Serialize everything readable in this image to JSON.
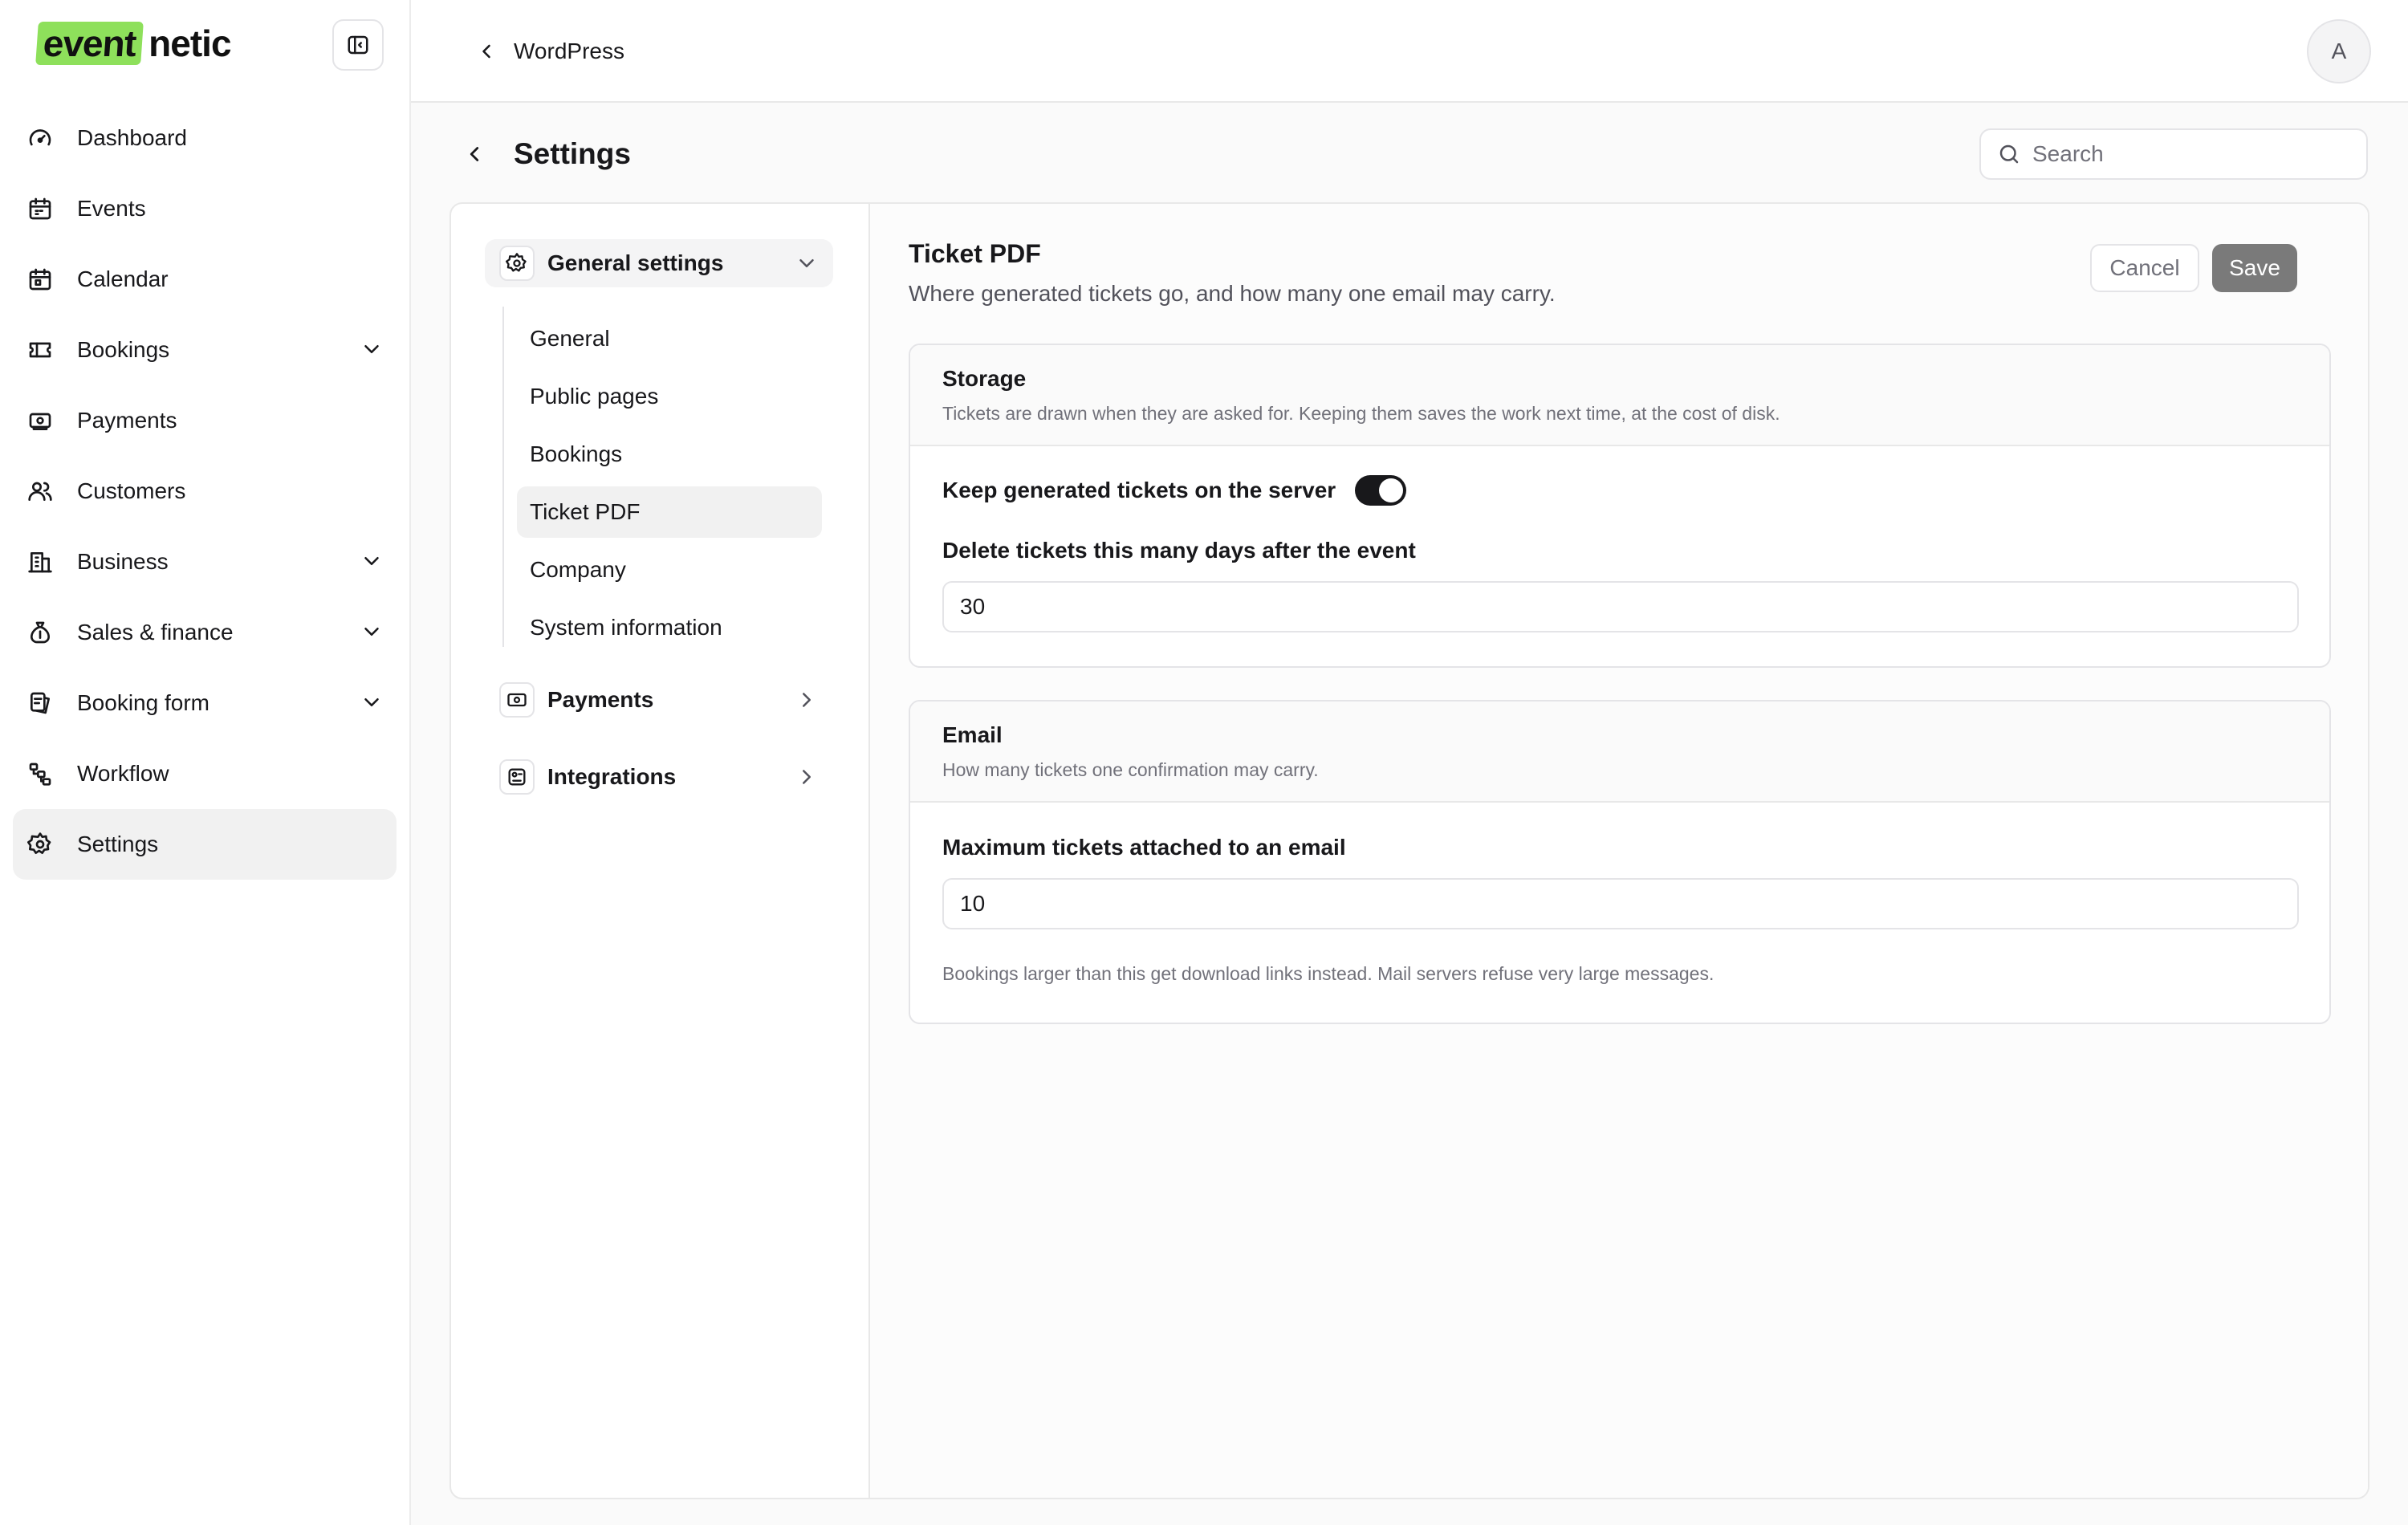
{
  "brand": {
    "logo_highlight": "event",
    "logo_rest": "netic",
    "accent": "#8ee05b"
  },
  "sidebar": {
    "items": [
      {
        "label": "Dashboard",
        "icon": "gauge-icon"
      },
      {
        "label": "Events",
        "icon": "calendar-icon"
      },
      {
        "label": "Calendar",
        "icon": "calendar-grid-icon"
      },
      {
        "label": "Bookings",
        "icon": "ticket-icon",
        "expandable": true
      },
      {
        "label": "Payments",
        "icon": "banknote-icon"
      },
      {
        "label": "Customers",
        "icon": "users-icon"
      },
      {
        "label": "Business",
        "icon": "building-icon",
        "expandable": true
      },
      {
        "label": "Sales & finance",
        "icon": "money-bag-icon",
        "expandable": true
      },
      {
        "label": "Booking form",
        "icon": "form-icon",
        "expandable": true
      },
      {
        "label": "Workflow",
        "icon": "workflow-icon"
      },
      {
        "label": "Settings",
        "icon": "gear-icon",
        "active": true
      }
    ]
  },
  "topbar": {
    "back_label": "WordPress",
    "avatar_initial": "A"
  },
  "page": {
    "title": "Settings",
    "search_placeholder": "Search"
  },
  "settings_nav": {
    "general": {
      "label": "General settings",
      "items": [
        "General",
        "Public pages",
        "Bookings",
        "Ticket PDF",
        "Company",
        "System information"
      ],
      "active": "Ticket PDF"
    },
    "payments": {
      "label": "Payments"
    },
    "integrations": {
      "label": "Integrations"
    }
  },
  "section": {
    "title": "Ticket PDF",
    "description": "Where generated tickets go, and how many one email may carry.",
    "cancel_label": "Cancel",
    "save_label": "Save"
  },
  "storage": {
    "title": "Storage",
    "description": "Tickets are drawn when they are asked for. Keeping them saves the work next time, at the cost of disk.",
    "keep_label": "Keep generated tickets on the server",
    "keep_enabled": true,
    "delete_label": "Delete tickets this many days after the event",
    "delete_value": "30"
  },
  "email": {
    "title": "Email",
    "description": "How many tickets one confirmation may carry.",
    "max_label": "Maximum tickets attached to an email",
    "max_value": "10",
    "help": "Bookings larger than this get download links instead. Mail servers refuse very large messages."
  }
}
